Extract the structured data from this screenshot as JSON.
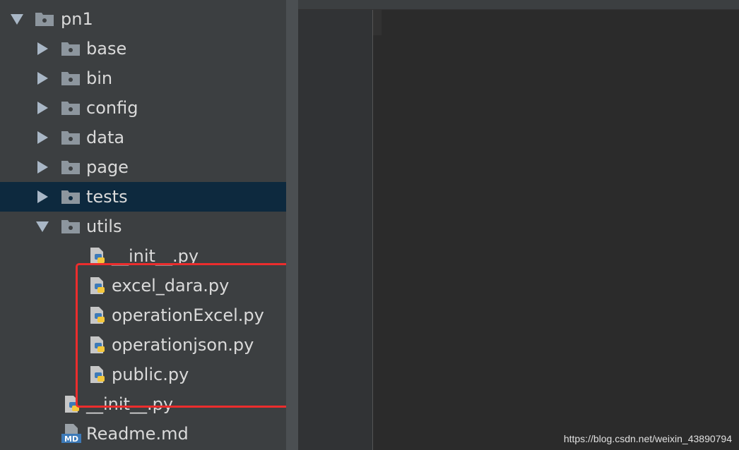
{
  "tree": {
    "root": {
      "label": "pn1"
    },
    "folders": [
      {
        "label": "base"
      },
      {
        "label": "bin"
      },
      {
        "label": "config"
      },
      {
        "label": "data"
      },
      {
        "label": "page"
      },
      {
        "label": "tests"
      },
      {
        "label": "utils"
      }
    ],
    "utils_files": [
      {
        "label": "__init__.py"
      },
      {
        "label": "excel_dara.py"
      },
      {
        "label": "operationExcel.py"
      },
      {
        "label": "operationjson.py"
      },
      {
        "label": "public.py"
      }
    ],
    "root_files": [
      {
        "label": "__init__.py"
      },
      {
        "label": "Readme.md"
      }
    ],
    "md_badge": "MD"
  },
  "colors": {
    "panel": "#3c3f41",
    "editor": "#2b2b2b",
    "selection": "#0d293e",
    "highlight_box": "#ec2d2d",
    "folder_icon": "#8d969e",
    "python_blue": "#3d7ab8",
    "python_yellow": "#f3c73c"
  },
  "watermark": "https://blog.csdn.net/weixin_43890794"
}
